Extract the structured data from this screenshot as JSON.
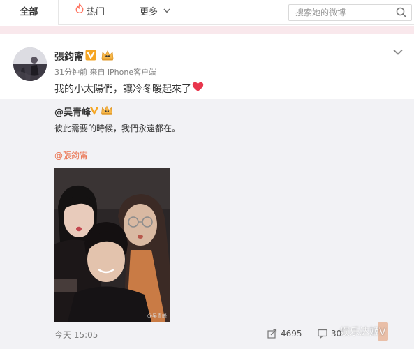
{
  "tabs": {
    "all": "全部",
    "hot": "热门",
    "more": "更多"
  },
  "search": {
    "placeholder": "搜索她的微博"
  },
  "post": {
    "author": "張鈞甯",
    "meta": "31分钟前 来自 iPhone客户端",
    "text": "我的小太陽們，讓冷冬暖起來了"
  },
  "repost": {
    "author": "@吴青峰",
    "text": "彼此需要的時候，我們永遠都在。",
    "mention": "@張鈞甯",
    "time": "今天 15:05",
    "repost_count": "4695",
    "comment_count": "30",
    "photo_watermark": "@吴青峰"
  },
  "overlay_watermark": "娱乐达姬V",
  "colors": {
    "accent_orange": "#eb7350",
    "pink_strip": "#f9e8ec",
    "repost_bg": "#f2f2f5",
    "heart": "#e8364d",
    "vip_badge": "#f5a623"
  },
  "icons": [
    "flame-icon",
    "chevron-down-icon",
    "search-icon",
    "verified-v-icon",
    "crown-icon",
    "heart-icon",
    "repost-icon",
    "comment-icon"
  ]
}
